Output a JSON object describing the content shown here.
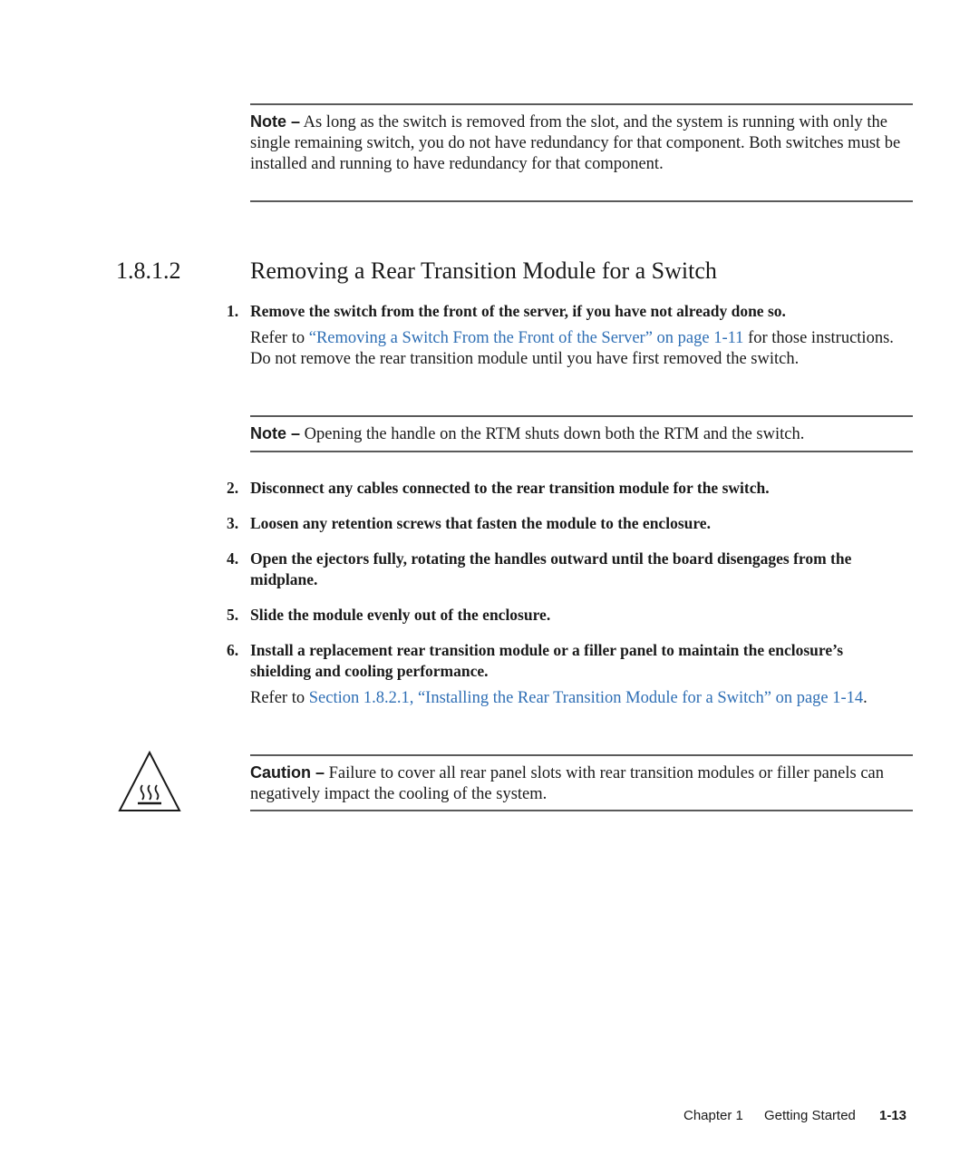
{
  "note1": {
    "label": "Note –",
    "text": " As long as the switch is removed from the slot, and the system is running with only the single remaining switch, you do not have redundancy for that component. Both switches must be installed and running to have redundancy for that component."
  },
  "section": {
    "number": "1.8.1.2",
    "title": "Removing a Rear Transition Module for a Switch"
  },
  "steps": [
    {
      "num": "1.",
      "text": "Remove the switch from the front of the server, if you have not already done so.",
      "detail": {
        "prefix": "Refer to ",
        "link": "“Removing a Switch From the Front of the Server” on page 1-11",
        "suffix": " for those instructions. Do not remove the rear transition module until you have first removed the switch."
      }
    },
    {
      "num": "2.",
      "text": "Disconnect any cables connected to the rear transition module for the switch."
    },
    {
      "num": "3.",
      "text": "Loosen any retention screws that fasten the module to the enclosure."
    },
    {
      "num": "4.",
      "text": "Open the ejectors fully, rotating the handles outward until the board disengages from the midplane."
    },
    {
      "num": "5.",
      "text": "Slide the module evenly out of the enclosure."
    },
    {
      "num": "6.",
      "text": "Install a replacement rear transition module or a filler panel to maintain the enclosure’s shielding and cooling performance.",
      "detail": {
        "prefix": "Refer to ",
        "link": "Section 1.8.2.1, “Installing the Rear Transition Module for a Switch” on page 1-14",
        "suffix": "."
      }
    }
  ],
  "note2": {
    "label": "Note –",
    "text": " Opening the handle on the RTM shuts down both the RTM and the switch."
  },
  "caution": {
    "icon": "hot-surface-warning-icon",
    "label": "Caution –",
    "text": " Failure to cover all rear panel slots with rear transition modules or filler panels can negatively impact the cooling of the system."
  },
  "footer": {
    "chapter": "Chapter 1",
    "chapter_title": "Getting Started",
    "page": "1-13"
  },
  "colors": {
    "link": "#2f6fb5",
    "rule": "#5a5a5a",
    "text": "#1a1a1a"
  }
}
